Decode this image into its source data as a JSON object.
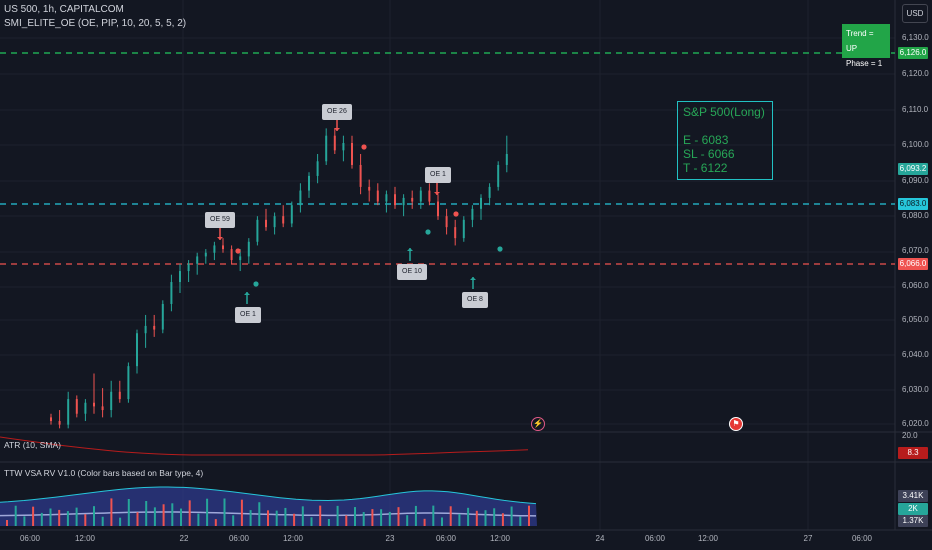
{
  "header": {
    "symbol_line": "US 500, 1h, CAPITALCOM",
    "indicator_line": "SMI_ELITE_OE (OE, PIP, 10, 20, 5, 5, 2)"
  },
  "currency_button": "USD",
  "trend_box": {
    "line1": "Trend = UP",
    "line2": "Phase = 1"
  },
  "trade_box": {
    "title": "S&P 500(Long)",
    "entry": "E - 6083",
    "stop": "SL - 6066",
    "target": "T - 6122"
  },
  "price_axis": [
    "6,130.0",
    "6,120.0",
    "6,110.0",
    "6,100.0",
    "6,090.0",
    "6,080.0",
    "6,070.0",
    "6,060.0",
    "6,050.0",
    "6,040.0",
    "6,030.0",
    "6,020.0"
  ],
  "price_tags": {
    "target": "6,126.0",
    "current": "6,093.2",
    "entry": "6,083.0",
    "stop": "6,066.0"
  },
  "callouts": {
    "oe26": "OE 26",
    "oe59": "OE 59",
    "oe1_top": "OE 1",
    "oe1_bottom": "OE 1",
    "oe10": "OE 10",
    "oe8": "OE 8"
  },
  "atr_pane": {
    "label": "ATR (10, SMA)",
    "scale_top": "20.0",
    "value": "8.3"
  },
  "vsa_pane": {
    "label": "TTW VSA RV V1.0 (Color bars based on Bar type, 4)",
    "tag_top": "3.41K",
    "tag_mid": "2K",
    "tag_bottom": "1.37K"
  },
  "time_axis": [
    "06:00",
    "12:00",
    "22",
    "06:00",
    "12:00",
    "23",
    "06:00",
    "12:00",
    "24",
    "06:00",
    "12:00",
    "27",
    "06:00"
  ],
  "colors": {
    "background": "#131722",
    "bull": "#26a69a",
    "bear": "#ef5350",
    "target_line": "#22c55e",
    "entry_line": "#26c6da",
    "stop_line": "#ef5350",
    "atr_line": "#b71c1c",
    "box_border": "#22c1c3",
    "box_text": "#27a657"
  },
  "chart_data": {
    "type": "candlestick",
    "ylim": [
      6017,
      6134
    ],
    "x_labels": [
      "06:00",
      "12:00",
      "22",
      "06:00",
      "12:00",
      "23",
      "06:00",
      "12:00"
    ],
    "candles": [
      [
        6021,
        6022,
        6019,
        6020
      ],
      [
        6020,
        6023,
        6018,
        6019
      ],
      [
        6019,
        6028,
        6018,
        6026
      ],
      [
        6026,
        6027,
        6021,
        6022
      ],
      [
        6022,
        6026,
        6020,
        6025
      ],
      [
        6025,
        6033,
        6022,
        6024
      ],
      [
        6024,
        6029,
        6021,
        6023
      ],
      [
        6023,
        6031,
        6021,
        6028
      ],
      [
        6028,
        6031,
        6025,
        6026
      ],
      [
        6026,
        6036,
        6025,
        6035
      ],
      [
        6035,
        6045,
        6033,
        6044
      ],
      [
        6044,
        6049,
        6040,
        6046
      ],
      [
        6046,
        6049,
        6043,
        6045
      ],
      [
        6045,
        6053,
        6044,
        6052
      ],
      [
        6052,
        6060,
        6050,
        6058
      ],
      [
        6058,
        6063,
        6055,
        6061
      ],
      [
        6061,
        6064,
        6058,
        6063
      ],
      [
        6063,
        6066,
        6060,
        6065
      ],
      [
        6065,
        6067,
        6063,
        6066
      ],
      [
        6066,
        6069,
        6064,
        6068
      ],
      [
        6068,
        6070,
        6066,
        6067
      ],
      [
        6067,
        6068,
        6063,
        6064
      ],
      [
        6064,
        6067,
        6061,
        6065
      ],
      [
        6065,
        6070,
        6063,
        6069
      ],
      [
        6069,
        6076,
        6068,
        6075
      ],
      [
        6075,
        6078,
        6072,
        6073
      ],
      [
        6073,
        6077,
        6071,
        6076
      ],
      [
        6076,
        6079,
        6073,
        6074
      ],
      [
        6074,
        6080,
        6073,
        6079
      ],
      [
        6079,
        6085,
        6077,
        6083
      ],
      [
        6083,
        6088,
        6081,
        6087
      ],
      [
        6087,
        6093,
        6085,
        6091
      ],
      [
        6091,
        6100,
        6090,
        6098
      ],
      [
        6098,
        6100,
        6093,
        6094
      ],
      [
        6094,
        6098,
        6091,
        6096
      ],
      [
        6096,
        6098,
        6089,
        6090
      ],
      [
        6090,
        6093,
        6082,
        6084
      ],
      [
        6084,
        6086,
        6080,
        6083
      ],
      [
        6083,
        6085,
        6079,
        6080
      ],
      [
        6080,
        6083,
        6077,
        6082
      ],
      [
        6082,
        6084,
        6078,
        6079
      ],
      [
        6079,
        6082,
        6076,
        6081
      ],
      [
        6081,
        6083,
        6078,
        6080
      ],
      [
        6080,
        6084,
        6078,
        6083
      ],
      [
        6083,
        6085,
        6079,
        6080
      ],
      [
        6080,
        6082,
        6075,
        6076
      ],
      [
        6076,
        6078,
        6071,
        6073
      ],
      [
        6073,
        6075,
        6068,
        6070
      ],
      [
        6070,
        6076,
        6069,
        6075
      ],
      [
        6075,
        6079,
        6073,
        6078
      ],
      [
        6078,
        6082,
        6075,
        6081
      ],
      [
        6081,
        6085,
        6079,
        6084
      ],
      [
        6084,
        6091,
        6083,
        6090
      ],
      [
        6090,
        6098,
        6088,
        6093
      ]
    ],
    "volume_range": [
      0,
      4000
    ],
    "atr_range": [
      0,
      20
    ]
  }
}
